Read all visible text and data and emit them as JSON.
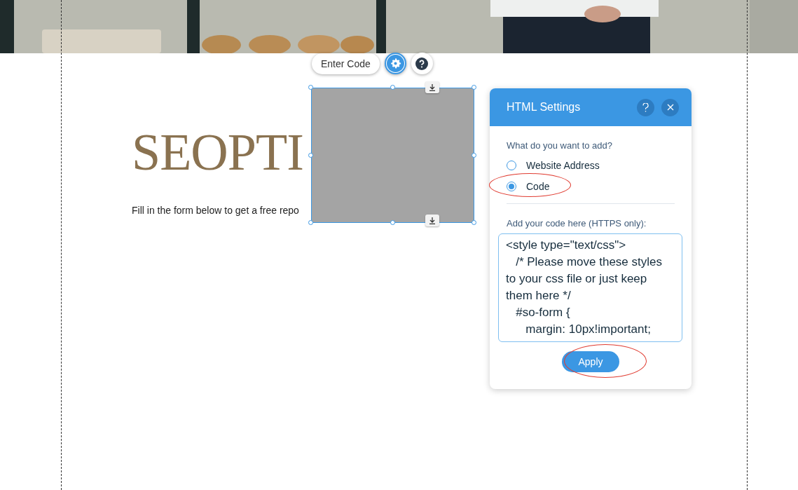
{
  "page": {
    "heading": "SEOPTI",
    "intro": "Fill in the form below to get a free repo"
  },
  "element_toolbar": {
    "button": "Enter Code"
  },
  "settings_panel": {
    "title": "HTML Settings",
    "question": "What do you want to add?",
    "options": [
      {
        "label": "Website Address",
        "selected": false,
        "highlighted": false
      },
      {
        "label": "Code",
        "selected": true,
        "highlighted": true
      }
    ],
    "code_label": "Add your code here (HTTPS only):",
    "code": "<style type=\"text/css\">\n   /* Please move these styles to your css file or just keep them here */\n   #so-form {\n      margin: 10px!important;",
    "apply": "Apply",
    "apply_highlighted": true
  }
}
